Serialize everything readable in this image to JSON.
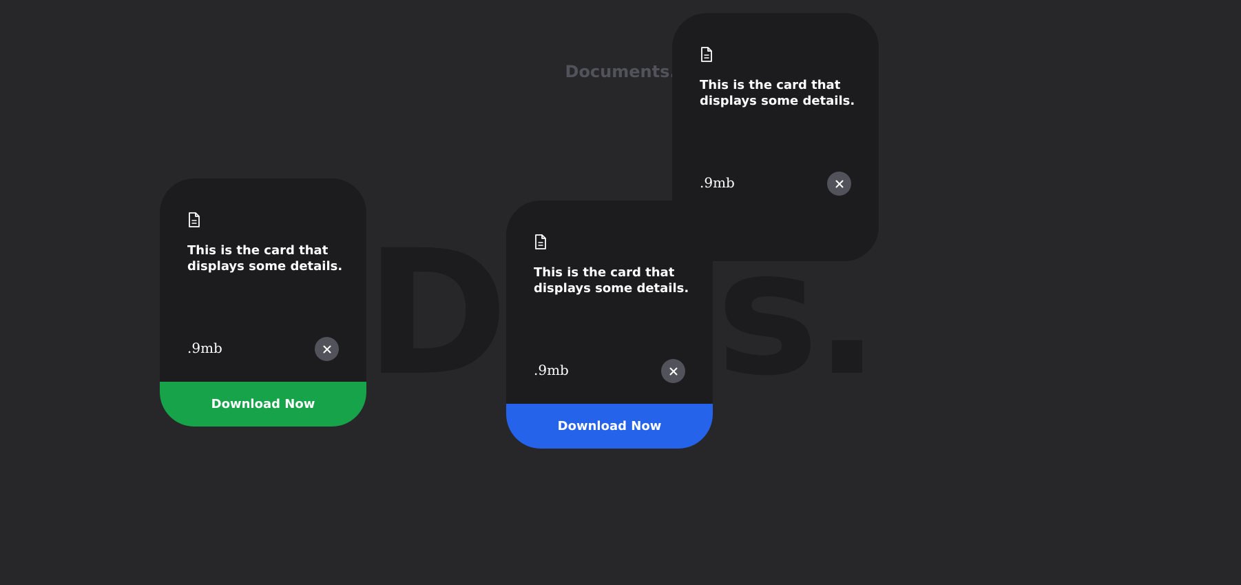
{
  "header": {
    "title": "Documents.",
    "watermark": "Docs."
  },
  "cards": [
    {
      "icon": "document-icon",
      "description": "This is the card that displays some details.",
      "size": ".9mb",
      "close_icon": "close-icon",
      "download_label": "Download Now",
      "download_color": "#16a34a"
    },
    {
      "icon": "document-icon",
      "description": "This is the card that displays some details.",
      "size": ".9mb",
      "close_icon": "close-icon",
      "download_label": "Download Now",
      "download_color": "#2563eb"
    },
    {
      "icon": "document-icon",
      "description": "This is the card that displays some details.",
      "size": ".9mb",
      "close_icon": "close-icon"
    }
  ],
  "colors": {
    "background": "#27272a",
    "card": "#1c1c1f",
    "close_button": "#52525b"
  }
}
